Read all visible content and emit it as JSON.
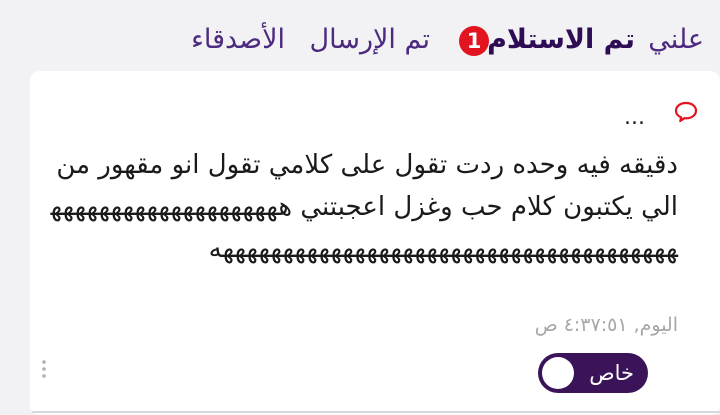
{
  "tabs": {
    "mine": "علني",
    "received": "تم الاستلام",
    "received_badge": "1",
    "sent": "تم الإرسال",
    "friends": "الأصدقاء"
  },
  "message_card": {
    "sender": "...",
    "text": "دقيقه فيه وحده ردت تقول على كلامي تقول انو مقهور من الي يكتبون كلام حب وغزل اعجبتني ههههههههههههههههههههههههههههههههههههههههههههههههههههههههههه",
    "timestamp": "اليوم, ٤:٣٧:٥١ ص",
    "privacy_label": "خاص",
    "privacy_on": true
  },
  "colors": {
    "accent": "#3a1358",
    "tab_text": "#4c2a80",
    "badge": "#e1141f",
    "comment_icon": "#e1141f",
    "timestamp": "#a7a7a7"
  },
  "icons": {
    "comment": "comment-icon",
    "more": "more-vertical-icon"
  }
}
